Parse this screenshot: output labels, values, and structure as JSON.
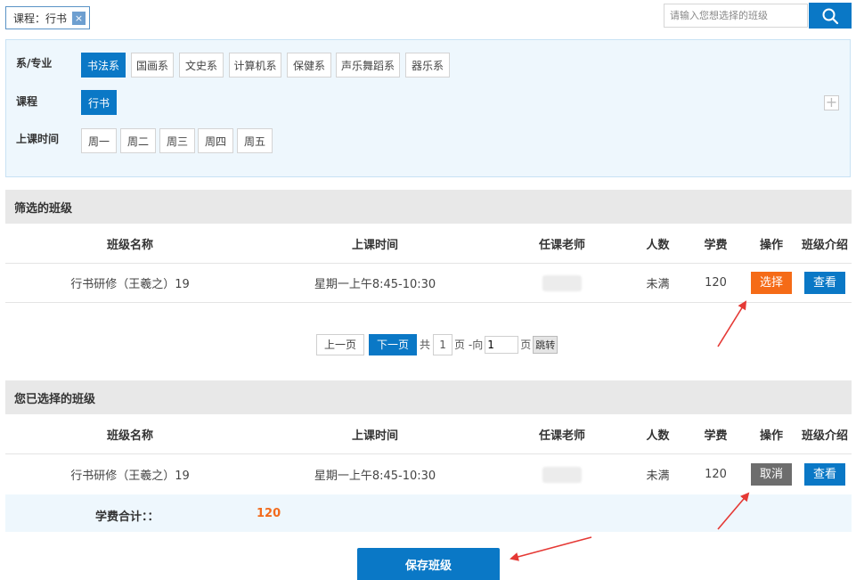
{
  "top": {
    "chip_label": "课程：行书",
    "chip_close": "×",
    "search_placeholder": "请输入您想选择的班级",
    "search_icon": "search-icon"
  },
  "filters": {
    "department": {
      "label": "系/专业",
      "options": [
        "书法系",
        "国画系",
        "文史系",
        "计算机系",
        "保健系",
        "声乐舞蹈系",
        "器乐系"
      ],
      "active": "书法系"
    },
    "course": {
      "label": "课程",
      "options": [
        "行书"
      ],
      "active": "行书"
    },
    "time": {
      "label": "上课时间",
      "options": [
        "周一",
        "周二",
        "周三",
        "周四",
        "周五"
      ]
    },
    "expand": "+"
  },
  "filtered": {
    "title": "筛选的班级",
    "columns": [
      "班级名称",
      "上课时间",
      "任课老师",
      "人数",
      "学费",
      "操作",
      "班级介绍"
    ],
    "rows": [
      {
        "name": "行书研修（王羲之）19",
        "time": "星期一上午8:45-10:30",
        "count": "未满",
        "fee": "120",
        "action": "选择",
        "intro": "查看"
      }
    ]
  },
  "pagination": {
    "prev": "上一页",
    "next": "下一页",
    "total_prefix": "共",
    "total_pages": "1",
    "goto_prefix": "页 -向",
    "goto_value": "1",
    "goto_suffix": "页",
    "jump": "跳转"
  },
  "selected": {
    "title": "您已选择的班级",
    "columns": [
      "班级名称",
      "上课时间",
      "任课老师",
      "人数",
      "学费",
      "操作",
      "班级介绍"
    ],
    "rows": [
      {
        "name": "行书研修（王羲之）19",
        "time": "星期一上午8:45-10:30",
        "count": "未满",
        "fee": "120",
        "action": "取消",
        "intro": "查看"
      }
    ],
    "total_label": "学费合计：：",
    "total_value": "120"
  },
  "save_label": "保存班级",
  "colors": {
    "primary": "#0a78c6",
    "orange": "#f56b17",
    "gray": "#6d6d6d",
    "arrow": "#e53935"
  }
}
